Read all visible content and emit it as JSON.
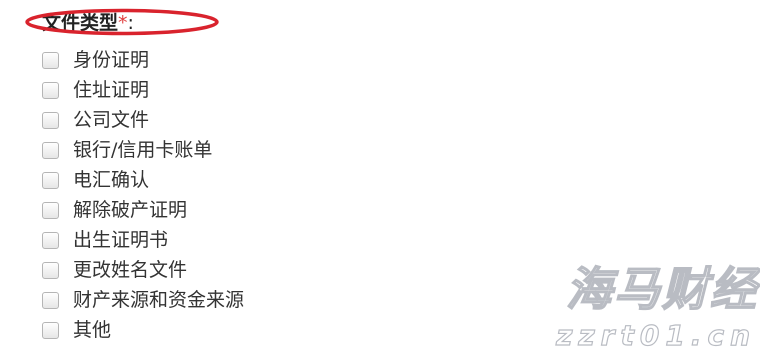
{
  "field": {
    "label": "文件类型",
    "required_mark": "*",
    "colon": ":"
  },
  "options": [
    {
      "label": "身份证明",
      "checked": false
    },
    {
      "label": "住址证明",
      "checked": false
    },
    {
      "label": "公司文件",
      "checked": false
    },
    {
      "label": "银行/信用卡账单",
      "checked": false
    },
    {
      "label": "电汇确认",
      "checked": false
    },
    {
      "label": "解除破产证明",
      "checked": false
    },
    {
      "label": "出生证明书",
      "checked": false
    },
    {
      "label": "更改姓名文件",
      "checked": false
    },
    {
      "label": "财产来源和资金来源",
      "checked": false
    },
    {
      "label": "其他",
      "checked": false
    }
  ],
  "watermark": {
    "line1": "海马财经",
    "line2": "zzrt01.cn"
  },
  "colors": {
    "required": "#e03c3c",
    "highlight": "#d9232d",
    "watermark": "#b9bcc3"
  }
}
